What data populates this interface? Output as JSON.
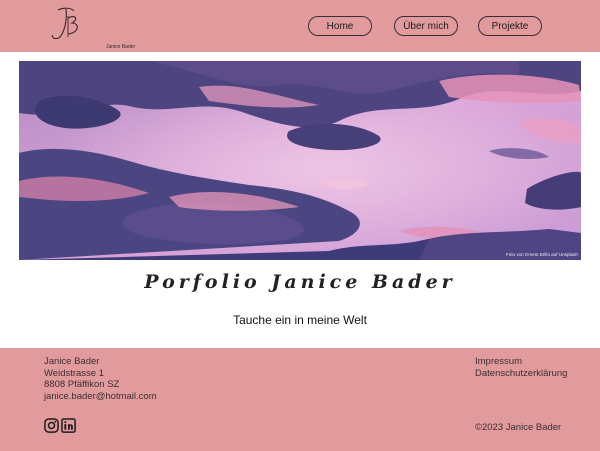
{
  "header": {
    "logo_icon": "jb-monogram-logo",
    "logo_caption": "Janice Bader",
    "nav": [
      {
        "label": "Home"
      },
      {
        "label": "Über mich"
      },
      {
        "label": "Projekte"
      }
    ],
    "background_color": "#e29b9c"
  },
  "hero": {
    "photo_credit": "Foto von Ernest Brillo auf Unsplash"
  },
  "main": {
    "title": "Porfolio Janice Bader",
    "subtitle": "Tauche ein in meine Welt"
  },
  "footer": {
    "address": [
      "Janice Bader",
      "Weidstrasse 1",
      "8808 Pfäffikon SZ",
      "janice.bader@hotmail.com"
    ],
    "links": [
      "Impressum",
      "Datenschutzerklärung"
    ],
    "social_icons": [
      "instagram-icon",
      "linkedin-icon"
    ],
    "copyright": "©2023 Janice Bader"
  }
}
